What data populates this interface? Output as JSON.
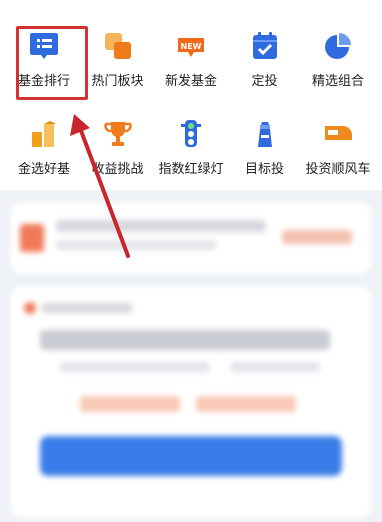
{
  "menu": {
    "row1": [
      {
        "label": "基金排行",
        "icon": "list-icon",
        "color": "#2f6bde"
      },
      {
        "label": "热门板块",
        "icon": "blocks-icon",
        "color": "#f08a1c"
      },
      {
        "label": "新发基金",
        "icon": "new-badge-icon",
        "color": "#f06a1c"
      },
      {
        "label": "定投",
        "icon": "calendar-check-icon",
        "color": "#2f6bde"
      },
      {
        "label": "精选组合",
        "icon": "pie-chart-icon",
        "color": "#2f6bde"
      }
    ],
    "row2": [
      {
        "label": "金选好基",
        "icon": "gold-bars-icon",
        "color": "#f0a01c"
      },
      {
        "label": "收益挑战",
        "icon": "trophy-icon",
        "color": "#f07a1c"
      },
      {
        "label": "指数红绿灯",
        "icon": "traffic-light-icon",
        "color": "#2f6bde"
      },
      {
        "label": "目标投",
        "icon": "lighthouse-icon",
        "color": "#2f6bde"
      },
      {
        "label": "投资顺风车",
        "icon": "train-icon",
        "color": "#f08a1c"
      }
    ]
  },
  "annotation": {
    "highlight_color": "#d23232"
  }
}
